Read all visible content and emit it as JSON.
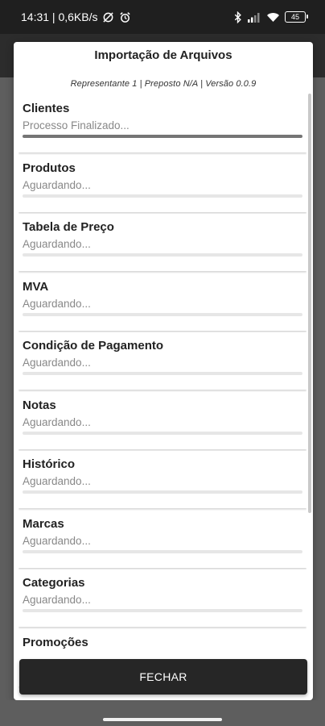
{
  "status_bar": {
    "time_speed": "14:31 | 0,6KB/s",
    "battery": "45",
    "icons": [
      "data-saver-icon",
      "alarm-icon",
      "bluetooth-icon",
      "signal-icon",
      "wifi-icon",
      "battery-icon"
    ]
  },
  "dialog": {
    "title": "Importação de Arquivos",
    "subtitle": "Representante 1 |  Preposto N/A  | Versão 0.0.9",
    "items": [
      {
        "name": "Clientes",
        "status": "Processo Finalizado...",
        "progress": 1.0
      },
      {
        "name": "Produtos",
        "status": "Aguardando...",
        "progress": 0.0
      },
      {
        "name": "Tabela de Preço",
        "status": "Aguardando...",
        "progress": 0.0
      },
      {
        "name": "MVA",
        "status": "Aguardando...",
        "progress": 0.0
      },
      {
        "name": "Condição de Pagamento",
        "status": "Aguardando...",
        "progress": 0.0
      },
      {
        "name": "Notas",
        "status": "Aguardando...",
        "progress": 0.0
      },
      {
        "name": "Histórico",
        "status": "Aguardando...",
        "progress": 0.0
      },
      {
        "name": "Marcas",
        "status": "Aguardando...",
        "progress": 0.0
      },
      {
        "name": "Categorias",
        "status": "Aguardando...",
        "progress": 0.0
      },
      {
        "name": "Promoções",
        "status": "",
        "progress": 0.0
      }
    ],
    "close_label": "FECHAR"
  }
}
